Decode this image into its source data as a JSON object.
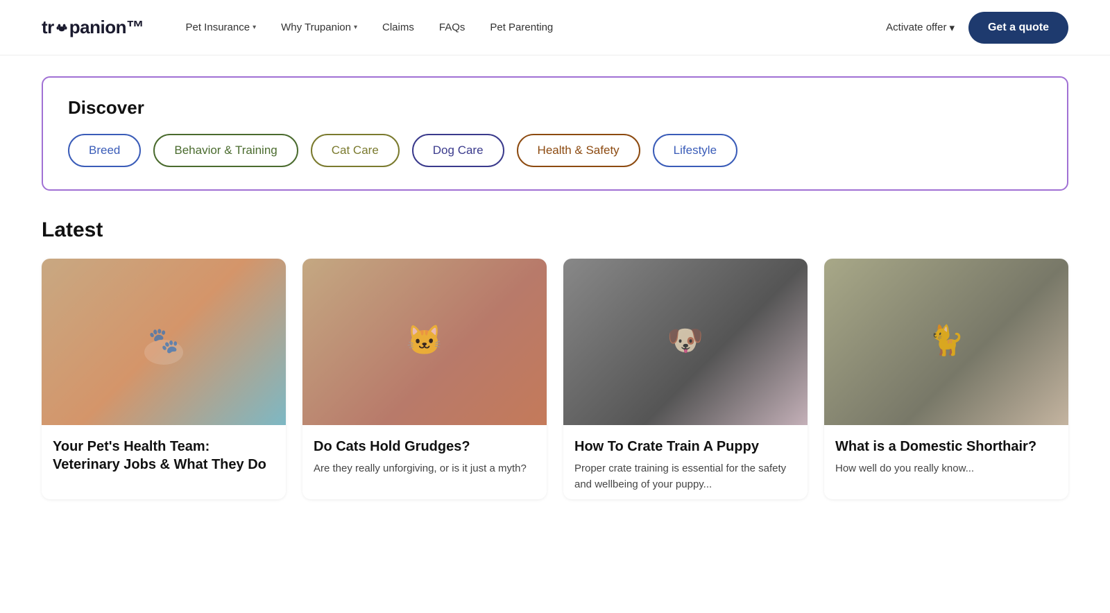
{
  "nav": {
    "logo": "trupanion",
    "links": [
      {
        "label": "Pet Insurance",
        "hasDropdown": true
      },
      {
        "label": "Why Trupanion",
        "hasDropdown": true
      },
      {
        "label": "Claims",
        "hasDropdown": false
      },
      {
        "label": "FAQs",
        "hasDropdown": false
      },
      {
        "label": "Pet Parenting",
        "hasDropdown": false
      }
    ],
    "activateOffer": "Activate offer",
    "getQuote": "Get a quote"
  },
  "discover": {
    "title": "Discover",
    "pills": [
      {
        "label": "Breed",
        "style": "breed"
      },
      {
        "label": "Behavior & Training",
        "style": "behavior"
      },
      {
        "label": "Cat Care",
        "style": "cat"
      },
      {
        "label": "Dog Care",
        "style": "dog"
      },
      {
        "label": "Health & Safety",
        "style": "health"
      },
      {
        "label": "Lifestyle",
        "style": "lifestyle"
      }
    ]
  },
  "latest": {
    "title": "Latest",
    "cards": [
      {
        "title": "Your Pet's Health Team: Veterinary Jobs & What They Do",
        "desc": "",
        "imageAlt": "Veterinarian holding a cat paw",
        "imageEmoji": "🐾"
      },
      {
        "title": "Do Cats Hold Grudges?",
        "desc": "Are they really unforgiving, or is it just a myth?",
        "imageAlt": "Cat peeking from under blanket",
        "imageEmoji": "🐱"
      },
      {
        "title": "How To Crate Train A Puppy",
        "desc": "Proper crate training is essential for the safety and wellbeing of your puppy...",
        "imageAlt": "Boston terrier puppy",
        "imageEmoji": "🐶"
      },
      {
        "title": "What is a Domestic Shorthair?",
        "desc": "How well do you really know...",
        "imageAlt": "Tabby cat sitting",
        "imageEmoji": "🐈"
      }
    ]
  }
}
